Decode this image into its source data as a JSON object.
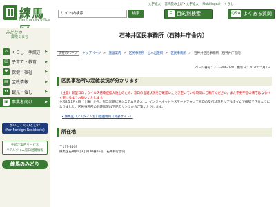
{
  "header": {
    "logo_text": "練馬区",
    "logo_sub": "Nerima city office",
    "util_links": [
      "文字拡大",
      "音声読み上げ・文字拡大",
      "Multilingual",
      "くらし"
    ],
    "search": {
      "value": "サイト内検索"
    },
    "search_button": "検索",
    "purpose_button": "目的別検索",
    "faq_button": "よくある質問",
    "purpose_icon": "目",
    "faq_icon": "Q&A"
  },
  "sidebar": {
    "tagline1": "みどりの",
    "tagline2": "風吹くまち",
    "nav": [
      {
        "label": "くらし・手続き",
        "icon": "house-icon",
        "glyph": "⌂"
      },
      {
        "label": "子育て・教育",
        "icon": "child-icon",
        "glyph": "☺"
      },
      {
        "label": "保健・福祉",
        "icon": "heart-icon",
        "glyph": "♥"
      },
      {
        "label": "区政情報",
        "icon": "building-icon",
        "glyph": "▤"
      },
      {
        "label": "観光・催し",
        "icon": "flower-icon",
        "glyph": "✿"
      },
      {
        "label": "事業者向け",
        "icon": "briefcase-icon",
        "glyph": "▣"
      }
    ],
    "banner_foreign_1": "がいこくのひとむけ",
    "banner_foreign_2": "(For Foreign Residents)",
    "banner_service_1": "手続き案内サービス",
    "banner_service_2": "リアルタイム窓口混雑情報",
    "banner_midori": "練馬のみどり"
  },
  "main": {
    "title": "石神井区民事務所（石神井庁舎内）",
    "breadcrumb_current": "現在のページ",
    "breadcrumbs": [
      "トップページ",
      "施設案内",
      "区民事務所・土木出張所",
      "区民事務所",
      "石神井区民事務所（石神井庁舎内）"
    ],
    "page_meta": "ページ番号：373-806-020　更新日：2020年5月1日",
    "section1_heading": "区民事務所の混雑状況が分かります",
    "notice_red": "（注意）新型コロナウイルス感染症拡大防止のため、窓口の混雑状況をご確認いただき空いている時間にご来庁ください。また不要不急の来庁はなるべく避けるようお願いいたします。",
    "notice_body": "令和2年1月4日（土曜）から、窓口混雑状況システムを導入し、インターネットやスマートフォンで窓口の受付状況をリアルタイムで確認できるようになりました。区民事務所の混雑状況は下記のリンクからご覧いただけます。",
    "link_text": "練馬区リアルタイム窓口混雑情報（外部サイト）",
    "section2_heading": "所在地",
    "address_postal": "〒177-8509",
    "address_line": "練馬区石神井町3丁目30番26号　石神井庁舎内"
  },
  "colors": {
    "brand_green": "#3a7a35",
    "notice_red": "#d00000",
    "link_blue": "#1a4fa0",
    "foreign_banner": "#1d3a7a"
  }
}
